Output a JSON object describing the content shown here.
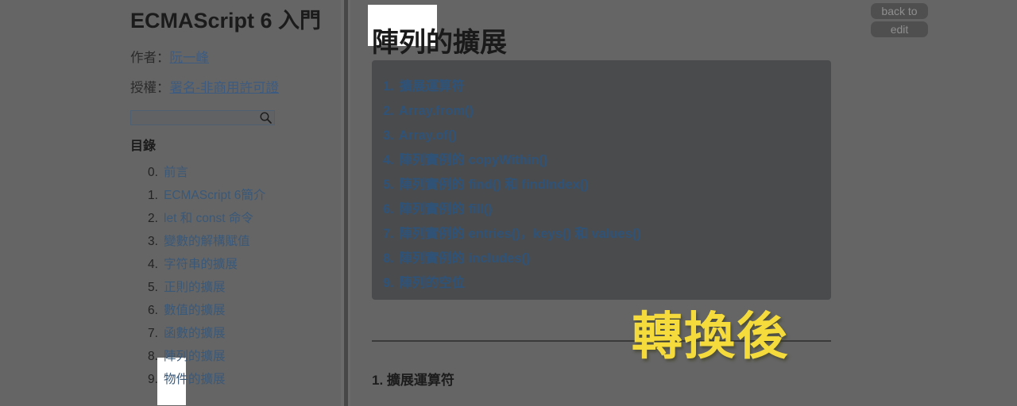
{
  "page": {
    "background_color": "#656565",
    "card_color": "#4a4b4d",
    "link_color": "#3a5878",
    "highlight_color": "#ffffff",
    "annotation_color": "#f5dc3c"
  },
  "sidebar": {
    "book_title": "ECMAScript 6 入門",
    "author_label": "作者：",
    "author_name": "阮一峰",
    "license_label": "授權：",
    "license_name": "署名-非商用許可證",
    "search": {
      "value": "",
      "placeholder": "",
      "icon": "search-icon"
    },
    "toc_heading": "目錄",
    "toc": [
      {
        "num": "0.",
        "label": "前言"
      },
      {
        "num": "1.",
        "label": "ECMAScript 6簡介"
      },
      {
        "num": "2.",
        "label": "let 和 const 命令"
      },
      {
        "num": "3.",
        "label": "變數的解構賦值"
      },
      {
        "num": "4.",
        "label": "字符串的擴展"
      },
      {
        "num": "5.",
        "label": "正則的擴展"
      },
      {
        "num": "6.",
        "label": "數值的擴展"
      },
      {
        "num": "7.",
        "label": "函數的擴展"
      },
      {
        "num": "8.",
        "label": "陣列的擴展"
      },
      {
        "num": "9.",
        "label": "物件的擴展"
      }
    ]
  },
  "main": {
    "title": "陣列的擴展",
    "toc": [
      {
        "num": "1.",
        "label": "擴展運算符"
      },
      {
        "num": "2.",
        "label": "Array.from()"
      },
      {
        "num": "3.",
        "label": "Array.of()"
      },
      {
        "num": "4.",
        "label": "陣列實例的 copyWithin()"
      },
      {
        "num": "5.",
        "label": "陣列實例的 find() 和 findIndex()"
      },
      {
        "num": "6.",
        "label": "陣列實例的 fill()"
      },
      {
        "num": "7.",
        "label": "陣列實例的 entries()，keys() 和 values()"
      },
      {
        "num": "8.",
        "label": "陣列實例的 includes()"
      },
      {
        "num": "9.",
        "label": "陣列的空位"
      }
    ],
    "section_heading": "1. 擴展運算符"
  },
  "toolbar": {
    "back_to_label": "back to",
    "edit_label": "edit"
  },
  "annotation": {
    "text": "轉換後"
  }
}
